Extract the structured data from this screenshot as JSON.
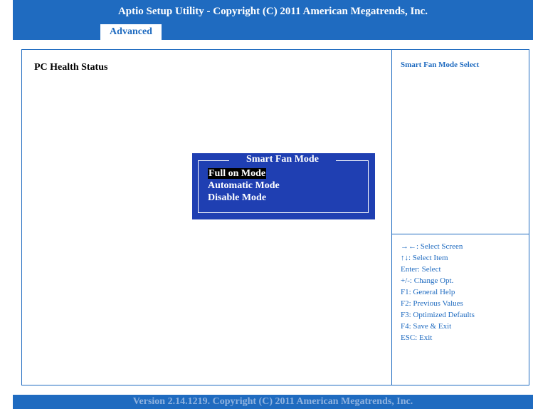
{
  "header": {
    "title": "Aptio Setup Utility - Copyright (C) 2011 American Megatrends, Inc.",
    "active_tab": "Advanced"
  },
  "main": {
    "section_title": "PC Health Status",
    "setting": {
      "label": "Smart Fan Mode",
      "value": "[Full on Mode]"
    }
  },
  "popup": {
    "title": "Smart Fan Mode",
    "options": [
      "Full on Mode",
      "Automatic Mode",
      "Disable Mode"
    ],
    "selected": "Full on Mode"
  },
  "help": {
    "title": "Smart Fan Mode Select",
    "keys": [
      "→←: Select Screen",
      "↑↓: Select Item",
      "Enter: Select",
      "+/-: Change Opt.",
      "F1: General Help",
      "F2: Previous Values",
      "F3: Optimized Defaults",
      "F4: Save & Exit",
      "ESC: Exit"
    ]
  },
  "footer": {
    "text": "Version 2.14.1219. Copyright (C) 2011 American Megatrends, Inc."
  },
  "colors": {
    "accent": "#1f6bc0",
    "popup_bg": "#1f3fb2",
    "highlight_bg": "#000000",
    "text_white": "#ffffff"
  }
}
